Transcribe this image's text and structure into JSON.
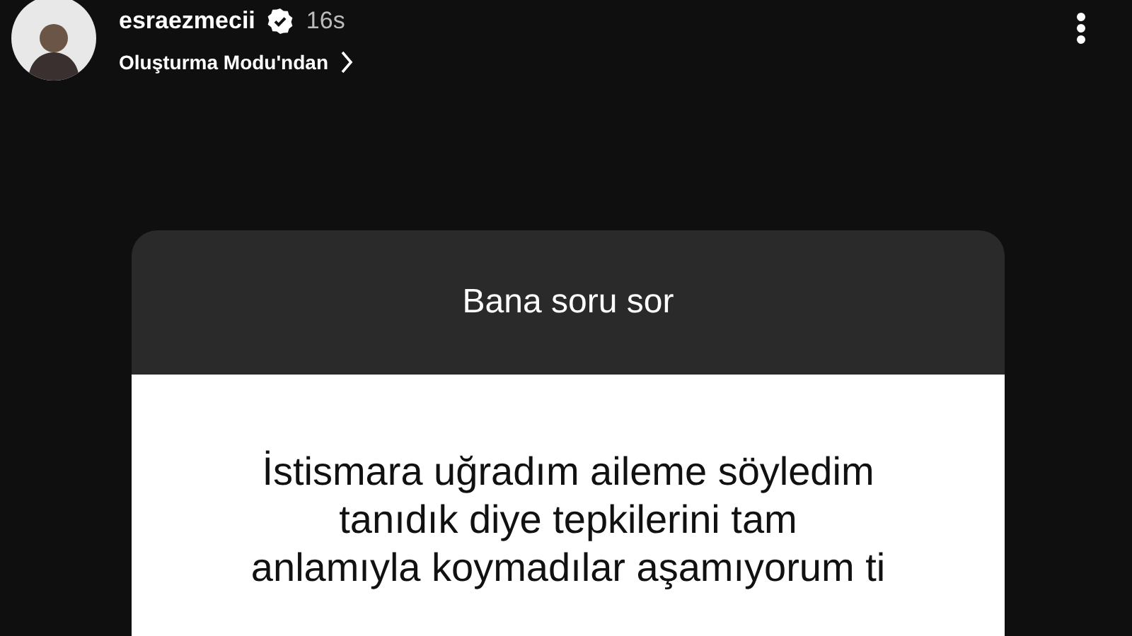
{
  "story_header": {
    "username": "esraezmecii",
    "verified": true,
    "time": "16s",
    "source": "Oluşturma Modu'ndan"
  },
  "question_card": {
    "title": "Bana soru sor",
    "answer_lines": [
      "İstismara uğradım aileme söyledim",
      "tanıdık diye tepkilerini tam",
      "anlamıyla koymadılar aşamıyorum ti"
    ]
  }
}
